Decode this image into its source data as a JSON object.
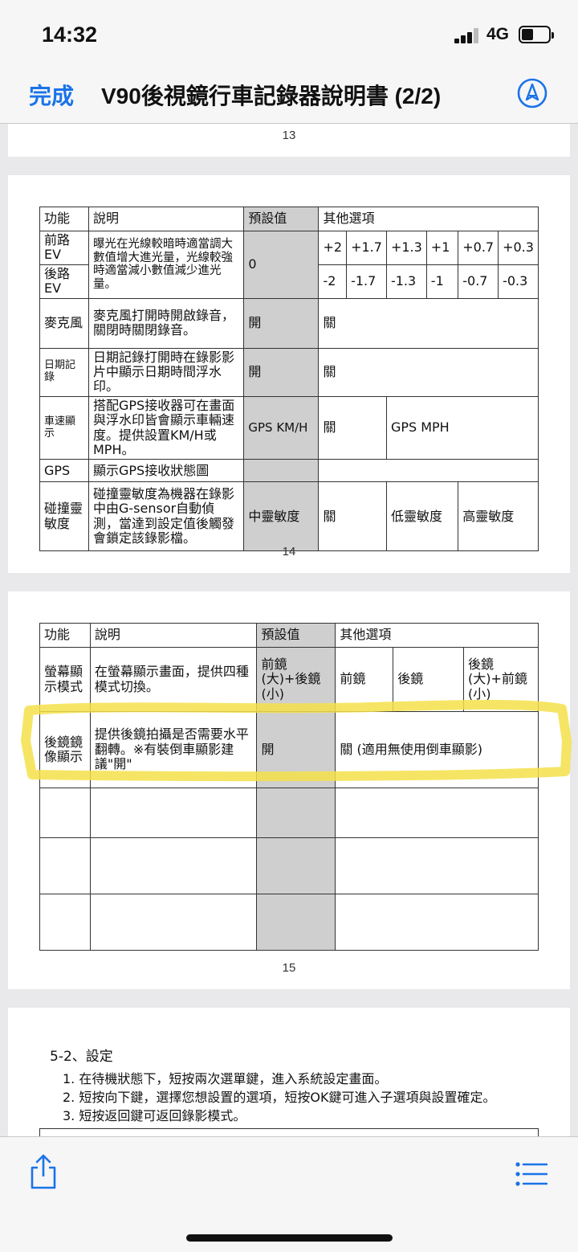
{
  "status": {
    "time": "14:32",
    "network": "4G"
  },
  "nav": {
    "done": "完成",
    "title": "V90後視鏡行車記錄器說明書 (2/2)"
  },
  "pages": {
    "p13": "13",
    "p14": "14",
    "p15": "15"
  },
  "header": {
    "func": "功能",
    "desc": "說明",
    "default": "預設值",
    "other": "其他選項"
  },
  "table14": {
    "ev_front": "前路EV",
    "ev_rear": "後路EV",
    "ev_desc": "曝光在光線較暗時適當調大數值增大進光量，光線較強時適當減小數值減少進光量。",
    "ev_default": "0",
    "ev_front_opts": [
      "+2",
      "+1.7",
      "+1.3",
      "+1",
      "+0.7",
      "+0.3"
    ],
    "ev_rear_opts": [
      "-2",
      "-1.7",
      "-1.3",
      "-1",
      "-0.7",
      "-0.3"
    ],
    "mic": "麥克風",
    "mic_desc": "麥克風打開時開啟錄音，關閉時關閉錄音。",
    "mic_default": "開",
    "mic_opt": "關",
    "date": "日期記錄",
    "date_desc": "日期記錄打開時在錄影影片中顯示日期時間浮水印。",
    "date_default": "開",
    "date_opt": "關",
    "speed": "車速顯示",
    "speed_desc": "搭配GPS接收器可在畫面與浮水印皆會顯示車輛速度。提供設置KM/H或MPH。",
    "speed_default": "GPS KM/H",
    "speed_opt1": "關",
    "speed_opt2": "GPS MPH",
    "gps": "GPS",
    "gps_desc": "顯示GPS接收狀態圖",
    "crash": "碰撞靈敏度",
    "crash_desc": "碰撞靈敏度為機器在錄影中由G-sensor自動偵測，當達到設定值後觸發會鎖定該錄影檔。",
    "crash_default": "中靈敏度",
    "crash_opt1": "關",
    "crash_opt2": "低靈敏度",
    "crash_opt3": "高靈敏度"
  },
  "table15": {
    "screen": "螢幕顯示模式",
    "screen_desc": "在螢幕顯示畫面，提供四種模式切換。",
    "screen_default": "前鏡(大)+後鏡(小)",
    "screen_opt1": "前鏡",
    "screen_opt2": "後鏡",
    "screen_opt3": "後鏡(大)+前鏡(小)",
    "mirror": "後鏡鏡像顯示",
    "mirror_desc": "提供後鏡拍攝是否需要水平翻轉。※有裝倒車顯影建議\"開\"",
    "mirror_default": "開",
    "mirror_opt": "關 (適用無使用倒車顯影)"
  },
  "section": {
    "title": "5-2、設定",
    "step1": "1. 在待機狀態下，短按兩次選單鍵，進入系統設定畫面。",
    "step2": "2. 短按向下鍵，選擇您想設置的選項，短按OK鍵可進入子選項與設置確定。",
    "step3": "3. 短按返回鍵可返回錄影模式。",
    "partial_func": "功能",
    "partial_desc": "說明",
    "partial_default": "預設值",
    "partial_other": "其他選項"
  },
  "colors": {
    "accent": "#1a73e8",
    "highlight": "#f5e04a",
    "cell_gray": "#cfcfcf"
  }
}
